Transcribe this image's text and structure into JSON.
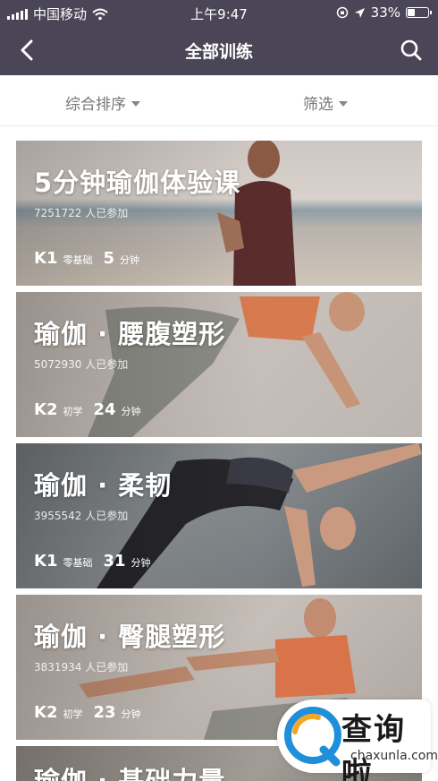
{
  "status_bar": {
    "carrier": "中国移动",
    "time": "上午9:47",
    "battery": "33%"
  },
  "navbar": {
    "title": "全部训练",
    "back_icon": "chevron-left-icon",
    "search_icon": "search-icon"
  },
  "filters": {
    "sort_label": "综合排序",
    "filter_label": "筛选"
  },
  "courses": [
    {
      "title": "5分钟瑜伽体验课",
      "participants": "7251722 人已参加",
      "level": "K1",
      "level_tag": "零基础",
      "duration": "5",
      "unit": "分钟"
    },
    {
      "title": "瑜伽 · 腰腹塑形",
      "participants": "5072930 人已参加",
      "level": "K2",
      "level_tag": "初学",
      "duration": "24",
      "unit": "分钟"
    },
    {
      "title": "瑜伽 · 柔韧",
      "participants": "3955542 人已参加",
      "level": "K1",
      "level_tag": "零基础",
      "duration": "31",
      "unit": "分钟"
    },
    {
      "title": "瑜伽 · 臀腿塑形",
      "participants": "3831934 人已参加",
      "level": "K2",
      "level_tag": "初学",
      "duration": "23",
      "unit": "分钟"
    },
    {
      "title": "瑜伽 · 基础力量"
    }
  ],
  "watermark": {
    "text": "查询啦",
    "url": "chaxunla.com"
  },
  "colors": {
    "header_bg": "#4b4657",
    "accent_orange": "#e07a4a"
  }
}
